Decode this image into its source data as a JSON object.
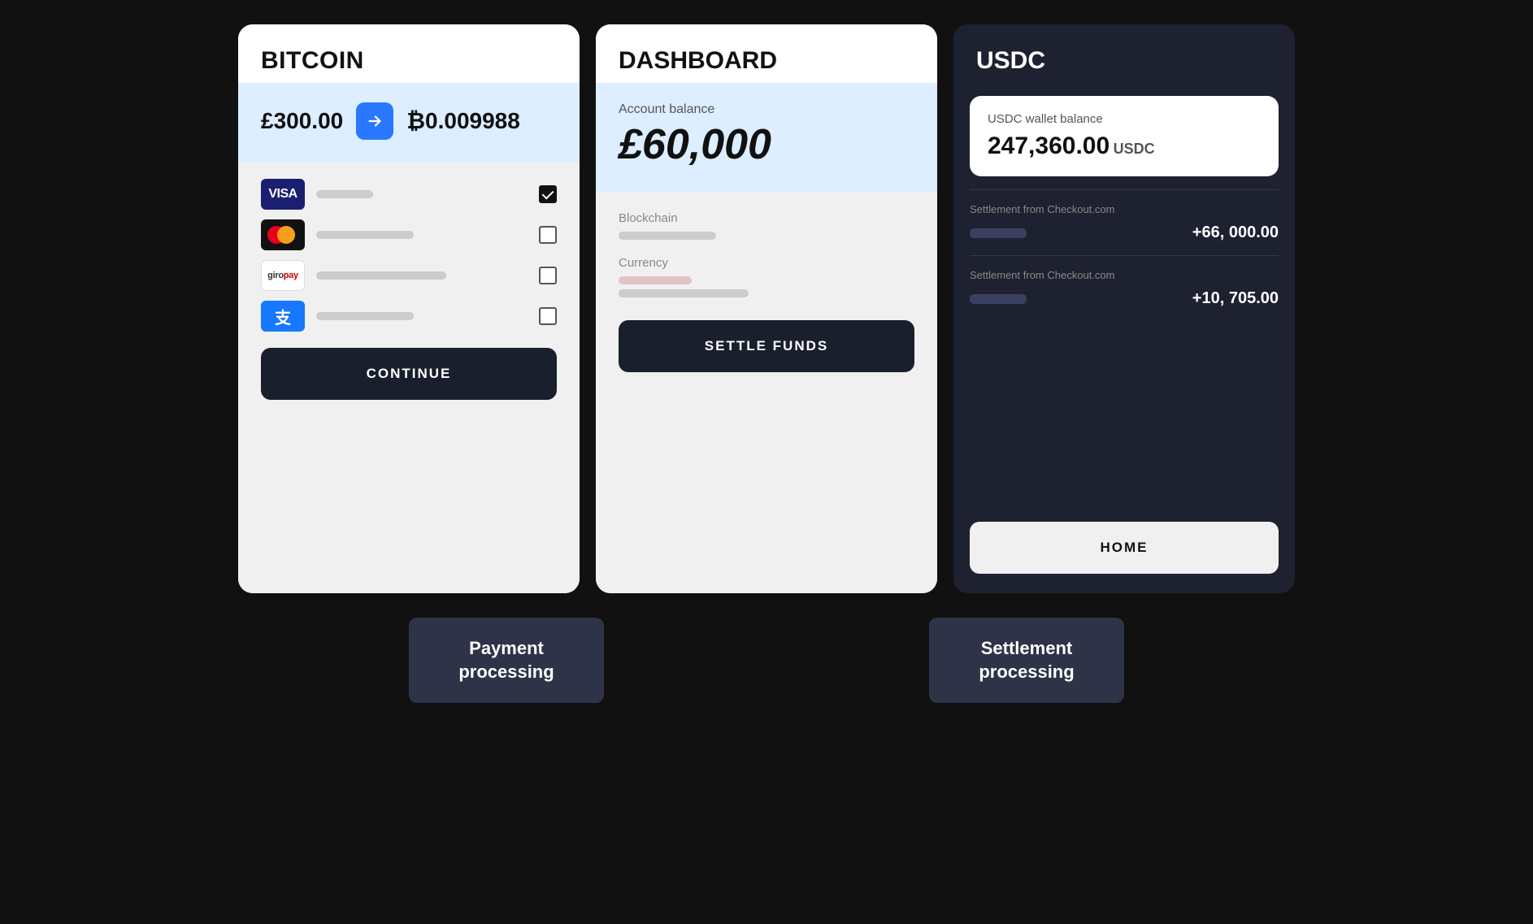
{
  "page": {
    "background": "#111"
  },
  "card1": {
    "title": "BITCOIN",
    "gbp_amount": "£300.00",
    "btc_amount": "₿0.009988",
    "payments": [
      {
        "type": "visa",
        "label_short": "",
        "label_long": "",
        "checked": true
      },
      {
        "type": "mastercard",
        "label_short": "",
        "label_long": "",
        "checked": false
      },
      {
        "type": "giropay",
        "label_short": "",
        "label_long": "",
        "checked": false
      },
      {
        "type": "alipay",
        "label_short": "",
        "label_long": "",
        "checked": false
      }
    ],
    "continue_label": "CONTINUE"
  },
  "card2": {
    "title": "DASHBOARD",
    "account_balance_label": "Account balance",
    "balance": "£60,000",
    "blockchain_label": "Blockchain",
    "currency_label": "Currency",
    "settle_button": "SETTLE FUNDS"
  },
  "card3": {
    "title": "USDC",
    "wallet_balance_label": "USDC wallet balance",
    "wallet_amount": "247,360.00",
    "wallet_currency": "USDC",
    "settlement1": {
      "label": "Settlement from Checkout.com",
      "amount": "+66, 000.00"
    },
    "settlement2": {
      "label": "Settlement from Checkout.com",
      "amount": "+10, 705.00"
    },
    "home_button": "HOME"
  },
  "bottom": {
    "payment_label": "Payment\nprocessing",
    "settlement_label": "Settlement\nprocessing"
  }
}
